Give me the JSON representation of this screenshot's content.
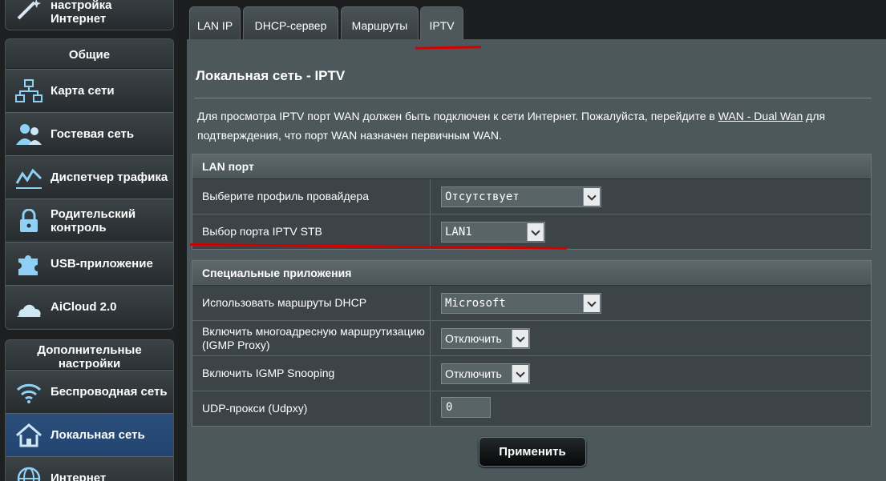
{
  "sidebar": {
    "top_partial_label": "настройка Интернет",
    "general": {
      "header": "Общие",
      "items": [
        {
          "label": "Карта сети"
        },
        {
          "label": "Гостевая сеть"
        },
        {
          "label": "Диспетчер трафика"
        },
        {
          "label": "Родительский контроль"
        },
        {
          "label": "USB-приложение"
        },
        {
          "label": "AiCloud 2.0"
        }
      ]
    },
    "advanced": {
      "header": "Дополнительные настройки",
      "items": [
        {
          "label": "Беспроводная сеть"
        },
        {
          "label": "Локальная сеть"
        },
        {
          "label": "Интернет"
        }
      ]
    }
  },
  "tabs": [
    {
      "label": "LAN IP"
    },
    {
      "label": "DHCP-сервер"
    },
    {
      "label": "Маршруты"
    },
    {
      "label": "IPTV"
    }
  ],
  "page": {
    "title": "Локальная сеть - IPTV",
    "desc_part1": "Для просмотра IPTV порт WAN должен быть подключен к сети Интернет. Пожалуйста, перейдите в ",
    "desc_link": "WAN - Dual Wan",
    "desc_part2": " для подтверждения, что порт WAN назначен первичным WAN."
  },
  "lan_section": {
    "header": "LAN порт",
    "rows": [
      {
        "label": "Выберите профиль провайдера",
        "value": "Отсутствует"
      },
      {
        "label": "Выбор порта IPTV STB",
        "value": "LAN1"
      }
    ]
  },
  "special_section": {
    "header": "Специальные приложения",
    "rows": [
      {
        "label": "Использовать маршруты DHCP",
        "value": "Microsoft"
      },
      {
        "label": "Включить многоадресную маршрутизацию (IGMP Proxy)",
        "value": "Отключить"
      },
      {
        "label": "Включить IGMP Snooping",
        "value": "Отключить"
      },
      {
        "label": "UDP-прокси (Udpxy)",
        "value": "0"
      }
    ]
  },
  "apply_label": "Применить",
  "colors": {
    "accent_active": "#2a4f7a",
    "panel": "#4d585c",
    "annotation": "#d40000"
  }
}
